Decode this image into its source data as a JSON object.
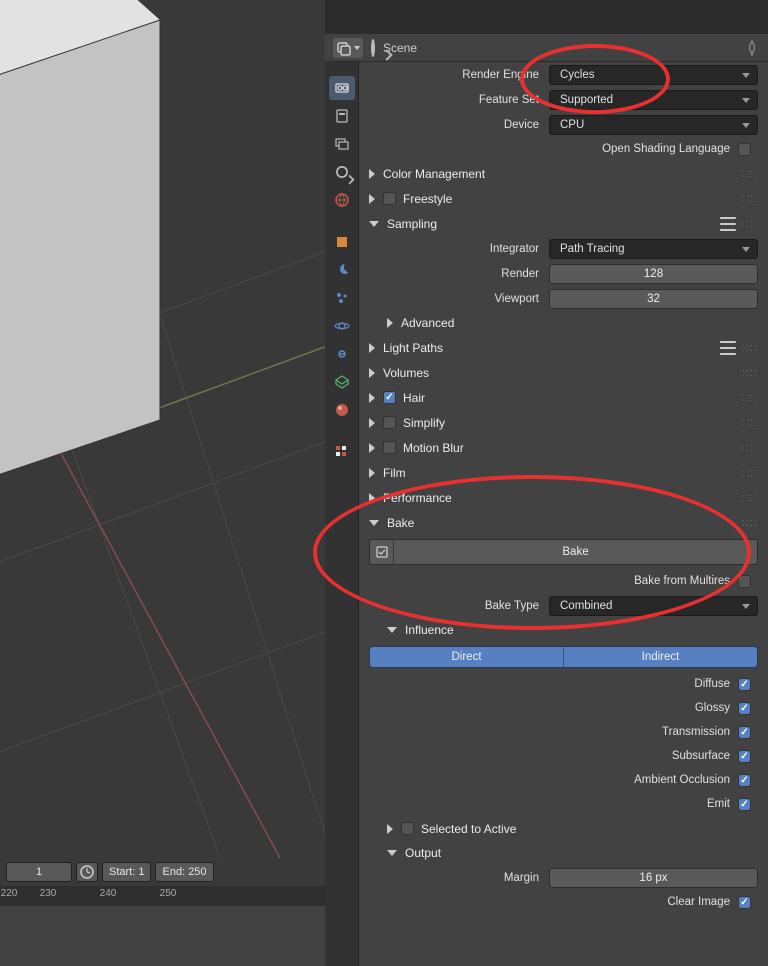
{
  "header": {
    "scene_label": "Scene"
  },
  "render": {
    "engine_label": "Render Engine",
    "engine_value": "Cycles",
    "featureset_label": "Feature Set",
    "featureset_value": "Supported",
    "device_label": "Device",
    "device_value": "CPU",
    "osl_label": "Open Shading Language"
  },
  "panels": {
    "color_mgmt": "Color Management",
    "freestyle": "Freestyle",
    "sampling": "Sampling",
    "advanced": "Advanced",
    "light_paths": "Light Paths",
    "volumes": "Volumes",
    "hair": "Hair",
    "simplify": "Simplify",
    "motion_blur": "Motion Blur",
    "film": "Film",
    "performance": "Performance",
    "bake": "Bake",
    "influence": "Influence",
    "selected_to_active": "Selected to Active",
    "output": "Output"
  },
  "sampling": {
    "integrator_label": "Integrator",
    "integrator_value": "Path Tracing",
    "render_label": "Render",
    "render_value": "128",
    "viewport_label": "Viewport",
    "viewport_value": "32"
  },
  "bake": {
    "button": "Bake",
    "multires_label": "Bake from Multires",
    "type_label": "Bake Type",
    "type_value": "Combined"
  },
  "influence": {
    "direct": "Direct",
    "indirect": "Indirect",
    "diffuse": "Diffuse",
    "glossy": "Glossy",
    "transmission": "Transmission",
    "subsurface": "Subsurface",
    "ao": "Ambient Occlusion",
    "emit": "Emit"
  },
  "output": {
    "margin_label": "Margin",
    "margin_value": "16 px",
    "clear_label": "Clear Image"
  },
  "timeline": {
    "current": "1",
    "start_label": "Start:",
    "start": "1",
    "end_label": "End:",
    "end": "250",
    "ticks": [
      "220",
      "230",
      "240",
      "250"
    ]
  }
}
